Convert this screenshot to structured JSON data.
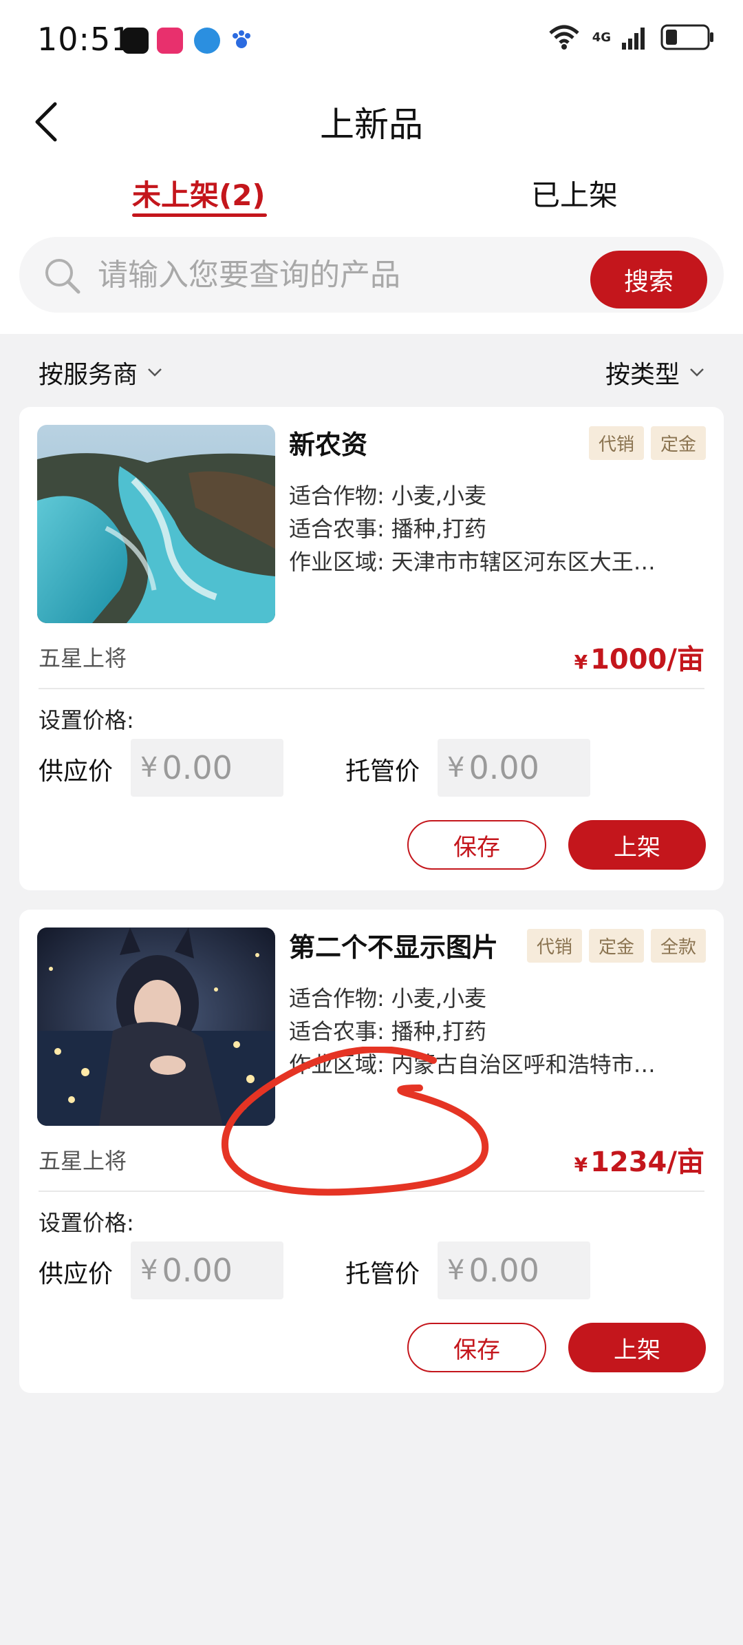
{
  "status_bar": {
    "time": "10:51",
    "apps": [
      {
        "icon": "app-icon-1",
        "color": "#111111"
      },
      {
        "icon": "app-icon-2",
        "color": "#e8306d"
      },
      {
        "icon": "app-icon-3",
        "color": "#2b8fe0"
      },
      {
        "icon": "app-icon-4",
        "color": "#2b6be0"
      }
    ],
    "network": "4G"
  },
  "header": {
    "title": "上新品",
    "back_icon": "back-arrow-icon"
  },
  "tabs": [
    {
      "label": "未上架(2)",
      "active": true
    },
    {
      "label": "已上架",
      "active": false
    }
  ],
  "search": {
    "placeholder": "请输入您要查询的产品",
    "button_label": "搜索"
  },
  "filters": {
    "left": "按服务商",
    "right": "按类型"
  },
  "products": [
    {
      "title": "新农资",
      "tags": [
        "代销",
        "定金"
      ],
      "crops_label": "适合作物:",
      "crops_value": "小麦,小麦",
      "farm_label": "适合农事:",
      "farm_value": "播种,打药",
      "area_label": "作业区域:",
      "area_value": "天津市市辖区河东区大王…",
      "owner": "五星上将",
      "price_symbol": "¥",
      "price": "1000/亩",
      "set_price_label": "设置价格:",
      "supply_label": "供应价",
      "supply_value": "0.00",
      "custody_label": "托管价",
      "custody_value": "0.00",
      "currency": "¥",
      "save_label": "保存",
      "shelf_label": "上架"
    },
    {
      "title": "第二个不显示图片",
      "tags": [
        "代销",
        "定金",
        "全款"
      ],
      "crops_label": "适合作物:",
      "crops_value": "小麦,小麦",
      "farm_label": "适合农事:",
      "farm_value": "播种,打药",
      "area_label": "作业区域:",
      "area_value": "内蒙古自治区呼和浩特市…",
      "owner": "五星上将",
      "price_symbol": "¥",
      "price": "1234/亩",
      "set_price_label": "设置价格:",
      "supply_label": "供应价",
      "supply_value": "0.00",
      "custody_label": "托管价",
      "custody_value": "0.00",
      "currency": "¥",
      "save_label": "保存",
      "shelf_label": "上架"
    }
  ],
  "colors": {
    "accent": "#c4161c",
    "tag_bg": "#f6ebdb",
    "tag_text": "#8a7350",
    "annotation": "#e53424"
  }
}
